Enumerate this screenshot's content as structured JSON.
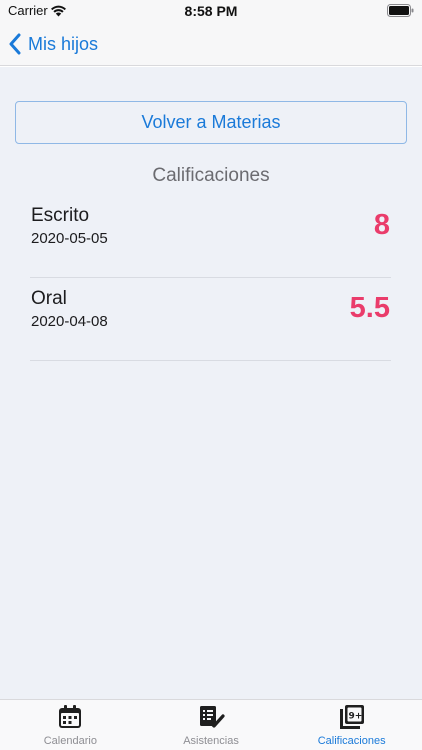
{
  "status_bar": {
    "carrier": "Carrier",
    "time": "8:58 PM"
  },
  "nav": {
    "back_label": "Mis hijos"
  },
  "main": {
    "back_button_label": "Volver a Materias",
    "section_title": "Calificaciones",
    "grades": [
      {
        "name": "Escrito",
        "date": "2020-05-05",
        "value": "8"
      },
      {
        "name": "Oral",
        "date": "2020-04-08",
        "value": "5.5"
      }
    ]
  },
  "tab_bar": {
    "tabs": [
      {
        "label": "Calendario",
        "icon": "calendar-icon",
        "active": false
      },
      {
        "label": "Asistencias",
        "icon": "attendance-checklist-icon",
        "active": false
      },
      {
        "label": "Calificaciones",
        "icon": "grades-9plus-icon",
        "active": true
      }
    ]
  },
  "colors": {
    "accent": "#1a7ad9",
    "grade": "#ea3c6b",
    "background": "#eef1f7"
  }
}
